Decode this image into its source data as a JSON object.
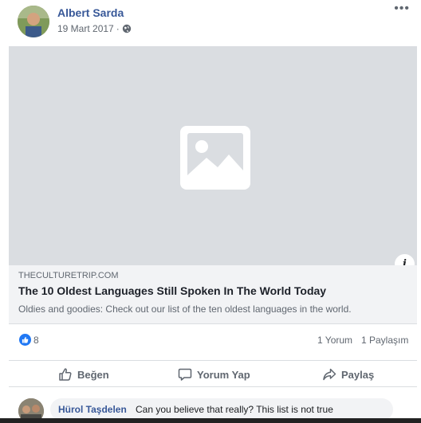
{
  "post": {
    "author": "Albert Sarda",
    "date": "19 Mart 2017",
    "separator": "·",
    "more": "•••",
    "link": {
      "domain": "THECULTURETRIP.COM",
      "title": "The 10 Oldest Languages Still Spoken In The World Today",
      "description": "Oldies and goodies: Check out our list of the ten oldest languages in the world.",
      "info_label": "i"
    },
    "stats": {
      "likes": "8",
      "comments": "1 Yorum",
      "shares": "1 Paylaşım"
    },
    "actions": {
      "like": "Beğen",
      "comment": "Yorum Yap",
      "share": "Paylaş"
    },
    "comment": {
      "author": "Hürol Taşdelen",
      "text": "Can you believe that really? This list is not true"
    }
  },
  "icons": {
    "globe": "globe-icon",
    "placeholder": "image-placeholder-icon",
    "like": "thumbs-up-icon",
    "comment": "speech-bubble-icon",
    "share": "share-arrow-icon"
  },
  "colors": {
    "link_blue": "#385898",
    "like_badge": "#2078f4",
    "placeholder_bg": "#dadde1",
    "caption_bg": "#f2f3f5"
  }
}
